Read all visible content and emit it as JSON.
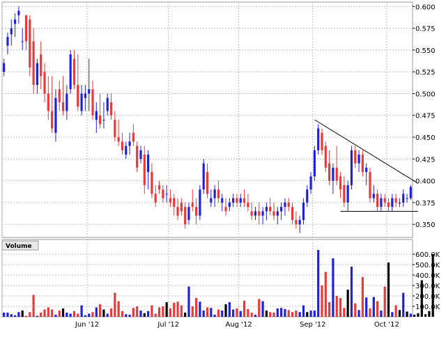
{
  "chart_data": [
    {
      "type": "candlestick",
      "colors": {
        "up": "#1f1fe0",
        "down": "#e83a3a",
        "neutral": "#000000",
        "grid": "#c0c0c0",
        "trendline": "#000000"
      },
      "ylim": [
        0.335,
        0.605
      ],
      "y_ticks": [
        "0.600",
        "0.575",
        "0.550",
        "0.525",
        "0.500",
        "0.475",
        "0.450",
        "0.425",
        "0.400",
        "0.375",
        "0.350"
      ],
      "x_labels": [
        "Jun '12",
        "Jul '12",
        "Aug '12",
        "Sep '12",
        "Oct '12"
      ],
      "label_index": [
        23,
        45,
        64,
        84,
        104
      ],
      "grid_index": [
        0,
        23,
        45,
        64,
        84,
        104
      ],
      "ohlc": [
        [
          0.525,
          0.54,
          0.52,
          0.535
        ],
        [
          0.555,
          0.57,
          0.545,
          0.565
        ],
        [
          0.568,
          0.585,
          0.555,
          0.575
        ],
        [
          0.58,
          0.592,
          0.565,
          0.585
        ],
        [
          0.59,
          0.6,
          0.58,
          0.595
        ],
        [
          0.56,
          0.575,
          0.55,
          0.56
        ],
        [
          0.59,
          0.59,
          0.55,
          0.56
        ],
        [
          0.585,
          0.59,
          0.52,
          0.53
        ],
        [
          0.56,
          0.575,
          0.5,
          0.51
        ],
        [
          0.51,
          0.54,
          0.5,
          0.535
        ],
        [
          0.545,
          0.56,
          0.505,
          0.52
        ],
        [
          0.525,
          0.535,
          0.49,
          0.5
        ],
        [
          0.5,
          0.52,
          0.47,
          0.48
        ],
        [
          0.48,
          0.52,
          0.455,
          0.46
        ],
        [
          0.455,
          0.505,
          0.445,
          0.495
        ],
        [
          0.505,
          0.515,
          0.48,
          0.49
        ],
        [
          0.49,
          0.52,
          0.475,
          0.48
        ],
        [
          0.48,
          0.51,
          0.47,
          0.5
        ],
        [
          0.505,
          0.55,
          0.5,
          0.545
        ],
        [
          0.54,
          0.55,
          0.505,
          0.51
        ],
        [
          0.51,
          0.545,
          0.48,
          0.485
        ],
        [
          0.48,
          0.51,
          0.475,
          0.5
        ],
        [
          0.495,
          0.51,
          0.48,
          0.5
        ],
        [
          0.5,
          0.54,
          0.48,
          0.505
        ],
        [
          0.505,
          0.515,
          0.47,
          0.475
        ],
        [
          0.47,
          0.49,
          0.455,
          0.48
        ],
        [
          0.475,
          0.5,
          0.46,
          0.465
        ],
        [
          0.47,
          0.49,
          0.46,
          0.47
        ],
        [
          0.48,
          0.5,
          0.475,
          0.495
        ],
        [
          0.49,
          0.5,
          0.47,
          0.475
        ],
        [
          0.47,
          0.48,
          0.445,
          0.45
        ],
        [
          0.45,
          0.47,
          0.44,
          0.445
        ],
        [
          0.445,
          0.455,
          0.43,
          0.435
        ],
        [
          0.43,
          0.445,
          0.425,
          0.44
        ],
        [
          0.44,
          0.455,
          0.43,
          0.445
        ],
        [
          0.455,
          0.465,
          0.44,
          0.445
        ],
        [
          0.44,
          0.445,
          0.41,
          0.415
        ],
        [
          0.425,
          0.44,
          0.42,
          0.435
        ],
        [
          0.43,
          0.44,
          0.385,
          0.395
        ],
        [
          0.41,
          0.435,
          0.39,
          0.43
        ],
        [
          0.41,
          0.42,
          0.38,
          0.385
        ],
        [
          0.385,
          0.395,
          0.37,
          0.375
        ],
        [
          0.395,
          0.4,
          0.385,
          0.39
        ],
        [
          0.39,
          0.395,
          0.375,
          0.38
        ],
        [
          0.385,
          0.395,
          0.375,
          0.385
        ],
        [
          0.38,
          0.39,
          0.37,
          0.375
        ],
        [
          0.38,
          0.385,
          0.36,
          0.37
        ],
        [
          0.37,
          0.38,
          0.355,
          0.36
        ],
        [
          0.375,
          0.38,
          0.36,
          0.365
        ],
        [
          0.37,
          0.375,
          0.345,
          0.35
        ],
        [
          0.355,
          0.375,
          0.35,
          0.37
        ],
        [
          0.375,
          0.39,
          0.365,
          0.37
        ],
        [
          0.37,
          0.38,
          0.35,
          0.36
        ],
        [
          0.36,
          0.395,
          0.355,
          0.39
        ],
        [
          0.39,
          0.425,
          0.385,
          0.42
        ],
        [
          0.41,
          0.42,
          0.38,
          0.385
        ],
        [
          0.375,
          0.39,
          0.37,
          0.38
        ],
        [
          0.38,
          0.395,
          0.37,
          0.39
        ],
        [
          0.39,
          0.4,
          0.375,
          0.38
        ],
        [
          0.375,
          0.385,
          0.365,
          0.38
        ],
        [
          0.37,
          0.38,
          0.36,
          0.365
        ],
        [
          0.37,
          0.38,
          0.365,
          0.375
        ],
        [
          0.375,
          0.385,
          0.37,
          0.38
        ],
        [
          0.38,
          0.385,
          0.37,
          0.375
        ],
        [
          0.375,
          0.385,
          0.37,
          0.38
        ],
        [
          0.38,
          0.39,
          0.37,
          0.375
        ],
        [
          0.375,
          0.385,
          0.365,
          0.37
        ],
        [
          0.365,
          0.375,
          0.355,
          0.36
        ],
        [
          0.36,
          0.37,
          0.355,
          0.365
        ],
        [
          0.365,
          0.375,
          0.35,
          0.36
        ],
        [
          0.36,
          0.37,
          0.35,
          0.365
        ],
        [
          0.365,
          0.375,
          0.355,
          0.37
        ],
        [
          0.37,
          0.38,
          0.36,
          0.365
        ],
        [
          0.365,
          0.375,
          0.355,
          0.36
        ],
        [
          0.36,
          0.37,
          0.35,
          0.365
        ],
        [
          0.365,
          0.375,
          0.355,
          0.37
        ],
        [
          0.37,
          0.38,
          0.36,
          0.375
        ],
        [
          0.375,
          0.38,
          0.365,
          0.37
        ],
        [
          0.37,
          0.375,
          0.35,
          0.355
        ],
        [
          0.355,
          0.365,
          0.345,
          0.35
        ],
        [
          0.35,
          0.36,
          0.34,
          0.355
        ],
        [
          0.355,
          0.38,
          0.35,
          0.375
        ],
        [
          0.375,
          0.395,
          0.37,
          0.39
        ],
        [
          0.39,
          0.41,
          0.385,
          0.405
        ],
        [
          0.405,
          0.44,
          0.4,
          0.435
        ],
        [
          0.435,
          0.465,
          0.43,
          0.46
        ],
        [
          0.455,
          0.46,
          0.43,
          0.435
        ],
        [
          0.44,
          0.445,
          0.41,
          0.415
        ],
        [
          0.42,
          0.435,
          0.395,
          0.4
        ],
        [
          0.4,
          0.42,
          0.385,
          0.415
        ],
        [
          0.415,
          0.44,
          0.395,
          0.4
        ],
        [
          0.405,
          0.41,
          0.38,
          0.39
        ],
        [
          0.395,
          0.405,
          0.37,
          0.375
        ],
        [
          0.375,
          0.4,
          0.365,
          0.395
        ],
        [
          0.395,
          0.44,
          0.39,
          0.435
        ],
        [
          0.435,
          0.44,
          0.415,
          0.42
        ],
        [
          0.42,
          0.435,
          0.41,
          0.43
        ],
        [
          0.43,
          0.435,
          0.405,
          0.41
        ],
        [
          0.41,
          0.42,
          0.395,
          0.415
        ],
        [
          0.41,
          0.415,
          0.375,
          0.38
        ],
        [
          0.38,
          0.395,
          0.375,
          0.385
        ],
        [
          0.385,
          0.39,
          0.365,
          0.37
        ],
        [
          0.37,
          0.385,
          0.365,
          0.38
        ],
        [
          0.38,
          0.385,
          0.37,
          0.375
        ],
        [
          0.375,
          0.38,
          0.365,
          0.37
        ],
        [
          0.37,
          0.385,
          0.365,
          0.38
        ],
        [
          0.38,
          0.385,
          0.37,
          0.375
        ],
        [
          0.375,
          0.38,
          0.37,
          0.375
        ],
        [
          0.375,
          0.39,
          0.37,
          0.385
        ],
        [
          0.38,
          0.385,
          0.375,
          0.38
        ],
        [
          0.38,
          0.395,
          0.378,
          0.393
        ]
      ],
      "trendlines": [
        {
          "from": [
            84,
            0.47
          ],
          "to": [
            112,
            0.397
          ]
        },
        {
          "from": [
            91,
            0.365
          ],
          "to": [
            112,
            0.365
          ]
        }
      ]
    },
    {
      "type": "bar",
      "title": "Volume",
      "ylim": [
        0,
        620
      ],
      "y_ticks": [
        "600.0K",
        "500.0K",
        "400.0K",
        "300.0K",
        "200.0K",
        "100.0K"
      ],
      "y_tick_values": [
        600,
        500,
        400,
        300,
        200,
        100
      ],
      "unit": "K",
      "values": [
        40,
        40,
        25,
        15,
        45,
        60,
        10,
        45,
        210,
        10,
        40,
        70,
        90,
        70,
        20,
        60,
        80,
        40,
        30,
        55,
        30,
        110,
        15,
        30,
        45,
        90,
        120,
        70,
        30,
        80,
        230,
        150,
        55,
        25,
        20,
        85,
        100,
        60,
        35,
        55,
        110,
        30,
        90,
        100,
        140,
        80,
        135,
        145,
        110,
        40,
        290,
        100,
        180,
        145,
        60,
        90,
        85,
        20,
        70,
        60,
        120,
        140,
        70,
        80,
        55,
        155,
        75,
        40,
        20,
        170,
        150,
        60,
        45,
        40,
        80,
        85,
        75,
        65,
        45,
        60,
        45,
        110,
        45,
        60,
        60,
        640,
        300,
        430,
        140,
        560,
        200,
        180,
        85,
        260,
        480,
        130,
        65,
        380,
        185,
        80,
        190,
        150,
        60,
        290,
        520,
        45,
        110,
        65,
        230,
        50,
        30,
        20,
        35,
        350,
        25,
        55,
        600
      ],
      "bar_colors": "ohlc-direction"
    }
  ]
}
